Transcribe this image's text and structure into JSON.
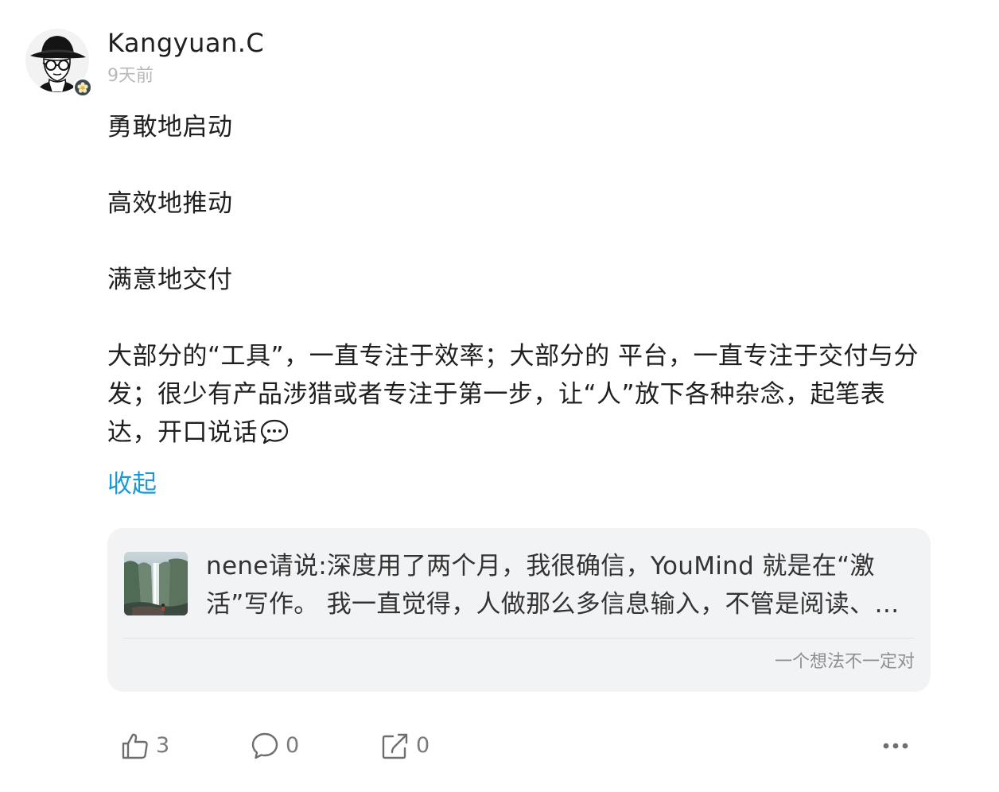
{
  "author": {
    "name": "Kangyuan.C",
    "time": "9天前",
    "avatar_icon": "hat-glasses-avatar-icon",
    "badge_icon": "flower-badge-icon"
  },
  "post": {
    "paragraphs": [
      "勇敢地启动",
      "高效地推动",
      "满意地交付",
      "大部分的“工具”，一直专注于效率；大部分的 平台，一直专注于交付与分发；很少有产品涉猎或者专注于第一步，让“人”放下各种杂念，起笔表达，开口说话"
    ],
    "trailing_emoji": "speech-bubble-icon",
    "collapse_label": "收起"
  },
  "quote": {
    "text": "nene请说:深度用了两个月，我很确信，YouMind 就是在“激活”写作。 我一直觉得，人做那么多信息输入，不管是阅读、听播客、看视频，最终都是为了输出。",
    "source": "一个想法不一定对",
    "thumbnail": "waterfall-thumbnail"
  },
  "actions": {
    "likes": "3",
    "comments": "0",
    "shares": "0"
  },
  "colors": {
    "link": "#1a9bd7",
    "card_bg": "#f2f3f5",
    "muted": "#b8b8b8",
    "text": "#1f1f1f"
  }
}
